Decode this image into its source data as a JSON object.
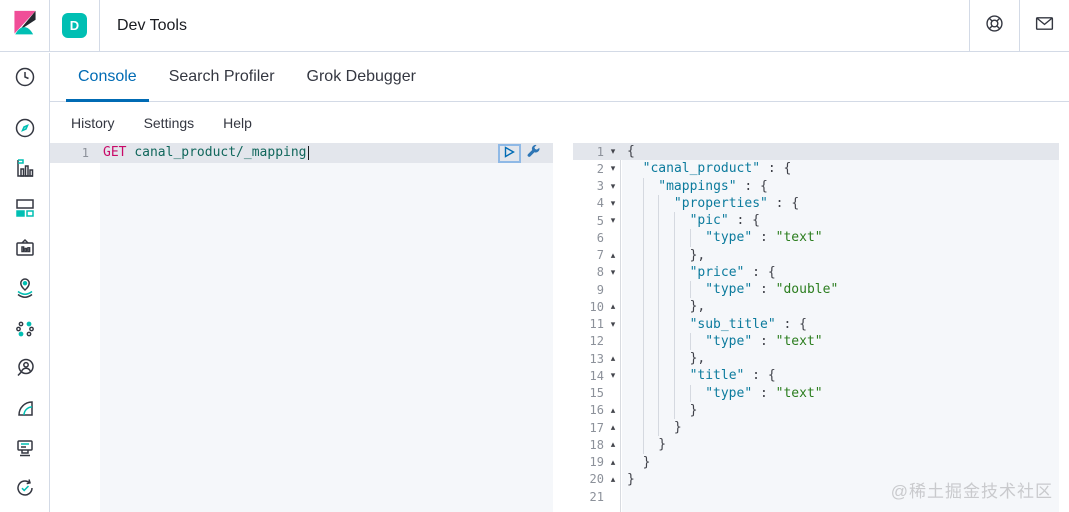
{
  "header": {
    "space_badge": "D",
    "breadcrumb": "Dev Tools"
  },
  "tabs": [
    {
      "label": "Console",
      "active": true
    },
    {
      "label": "Search Profiler",
      "active": false
    },
    {
      "label": "Grok Debugger",
      "active": false
    }
  ],
  "console_menu": [
    {
      "label": "History"
    },
    {
      "label": "Settings"
    },
    {
      "label": "Help"
    }
  ],
  "sidebar_icons": [
    "recent-clock",
    "discover-compass",
    "visualize-chart",
    "dashboard",
    "canvas",
    "maps",
    "machine-learning",
    "graph",
    "metrics",
    "apm",
    "uptime"
  ],
  "header_icons": [
    "help-life-ring",
    "newsfeed-envelope"
  ],
  "request": {
    "line_number": "1",
    "method": "GET",
    "path": "canal_product/_mapping"
  },
  "fold_icons": {
    "open": "▾",
    "close": "▴"
  },
  "response": {
    "lines": [
      {
        "n": "1",
        "fold": "open",
        "indent": 0,
        "active": true,
        "tokens": [
          {
            "c": "p",
            "t": "{"
          }
        ]
      },
      {
        "n": "2",
        "fold": "open",
        "indent": 1,
        "tokens": [
          {
            "c": "k",
            "t": "\"canal_product\""
          },
          {
            "c": "p",
            "t": " : {"
          }
        ]
      },
      {
        "n": "3",
        "fold": "open",
        "indent": 2,
        "tokens": [
          {
            "c": "k",
            "t": "\"mappings\""
          },
          {
            "c": "p",
            "t": " : {"
          }
        ]
      },
      {
        "n": "4",
        "fold": "open",
        "indent": 3,
        "tokens": [
          {
            "c": "k",
            "t": "\"properties\""
          },
          {
            "c": "p",
            "t": " : {"
          }
        ]
      },
      {
        "n": "5",
        "fold": "open",
        "indent": 4,
        "tokens": [
          {
            "c": "k",
            "t": "\"pic\""
          },
          {
            "c": "p",
            "t": " : {"
          }
        ]
      },
      {
        "n": "6",
        "fold": "",
        "indent": 5,
        "tokens": [
          {
            "c": "k",
            "t": "\"type\""
          },
          {
            "c": "p",
            "t": " : "
          },
          {
            "c": "s",
            "t": "\"text\""
          }
        ]
      },
      {
        "n": "7",
        "fold": "close",
        "indent": 4,
        "tokens": [
          {
            "c": "p",
            "t": "},"
          }
        ]
      },
      {
        "n": "8",
        "fold": "open",
        "indent": 4,
        "tokens": [
          {
            "c": "k",
            "t": "\"price\""
          },
          {
            "c": "p",
            "t": " : {"
          }
        ]
      },
      {
        "n": "9",
        "fold": "",
        "indent": 5,
        "tokens": [
          {
            "c": "k",
            "t": "\"type\""
          },
          {
            "c": "p",
            "t": " : "
          },
          {
            "c": "s",
            "t": "\"double\""
          }
        ]
      },
      {
        "n": "10",
        "fold": "close",
        "indent": 4,
        "tokens": [
          {
            "c": "p",
            "t": "},"
          }
        ]
      },
      {
        "n": "11",
        "fold": "open",
        "indent": 4,
        "tokens": [
          {
            "c": "k",
            "t": "\"sub_title\""
          },
          {
            "c": "p",
            "t": " : {"
          }
        ]
      },
      {
        "n": "12",
        "fold": "",
        "indent": 5,
        "tokens": [
          {
            "c": "k",
            "t": "\"type\""
          },
          {
            "c": "p",
            "t": " : "
          },
          {
            "c": "s",
            "t": "\"text\""
          }
        ]
      },
      {
        "n": "13",
        "fold": "close",
        "indent": 4,
        "tokens": [
          {
            "c": "p",
            "t": "},"
          }
        ]
      },
      {
        "n": "14",
        "fold": "open",
        "indent": 4,
        "tokens": [
          {
            "c": "k",
            "t": "\"title\""
          },
          {
            "c": "p",
            "t": " : {"
          }
        ]
      },
      {
        "n": "15",
        "fold": "",
        "indent": 5,
        "tokens": [
          {
            "c": "k",
            "t": "\"type\""
          },
          {
            "c": "p",
            "t": " : "
          },
          {
            "c": "s",
            "t": "\"text\""
          }
        ]
      },
      {
        "n": "16",
        "fold": "close",
        "indent": 4,
        "tokens": [
          {
            "c": "p",
            "t": "}"
          }
        ]
      },
      {
        "n": "17",
        "fold": "close",
        "indent": 3,
        "tokens": [
          {
            "c": "p",
            "t": "}"
          }
        ]
      },
      {
        "n": "18",
        "fold": "close",
        "indent": 2,
        "tokens": [
          {
            "c": "p",
            "t": "}"
          }
        ]
      },
      {
        "n": "19",
        "fold": "close",
        "indent": 1,
        "tokens": [
          {
            "c": "p",
            "t": "}"
          }
        ]
      },
      {
        "n": "20",
        "fold": "close",
        "indent": 0,
        "tokens": [
          {
            "c": "p",
            "t": "}"
          }
        ]
      },
      {
        "n": "21",
        "fold": "",
        "indent": 0,
        "tokens": []
      }
    ]
  },
  "watermark": "@稀土掘金技术社区",
  "colors": {
    "accent_teal": "#00bfb3",
    "accent_pink": "#f04e98",
    "primary_blue": "#006bb4",
    "border": "#d3dae6",
    "code_bg": "#f5f7fa",
    "method": "#c80a68",
    "key": "#0c7b9d",
    "string": "#2b7d1e"
  }
}
